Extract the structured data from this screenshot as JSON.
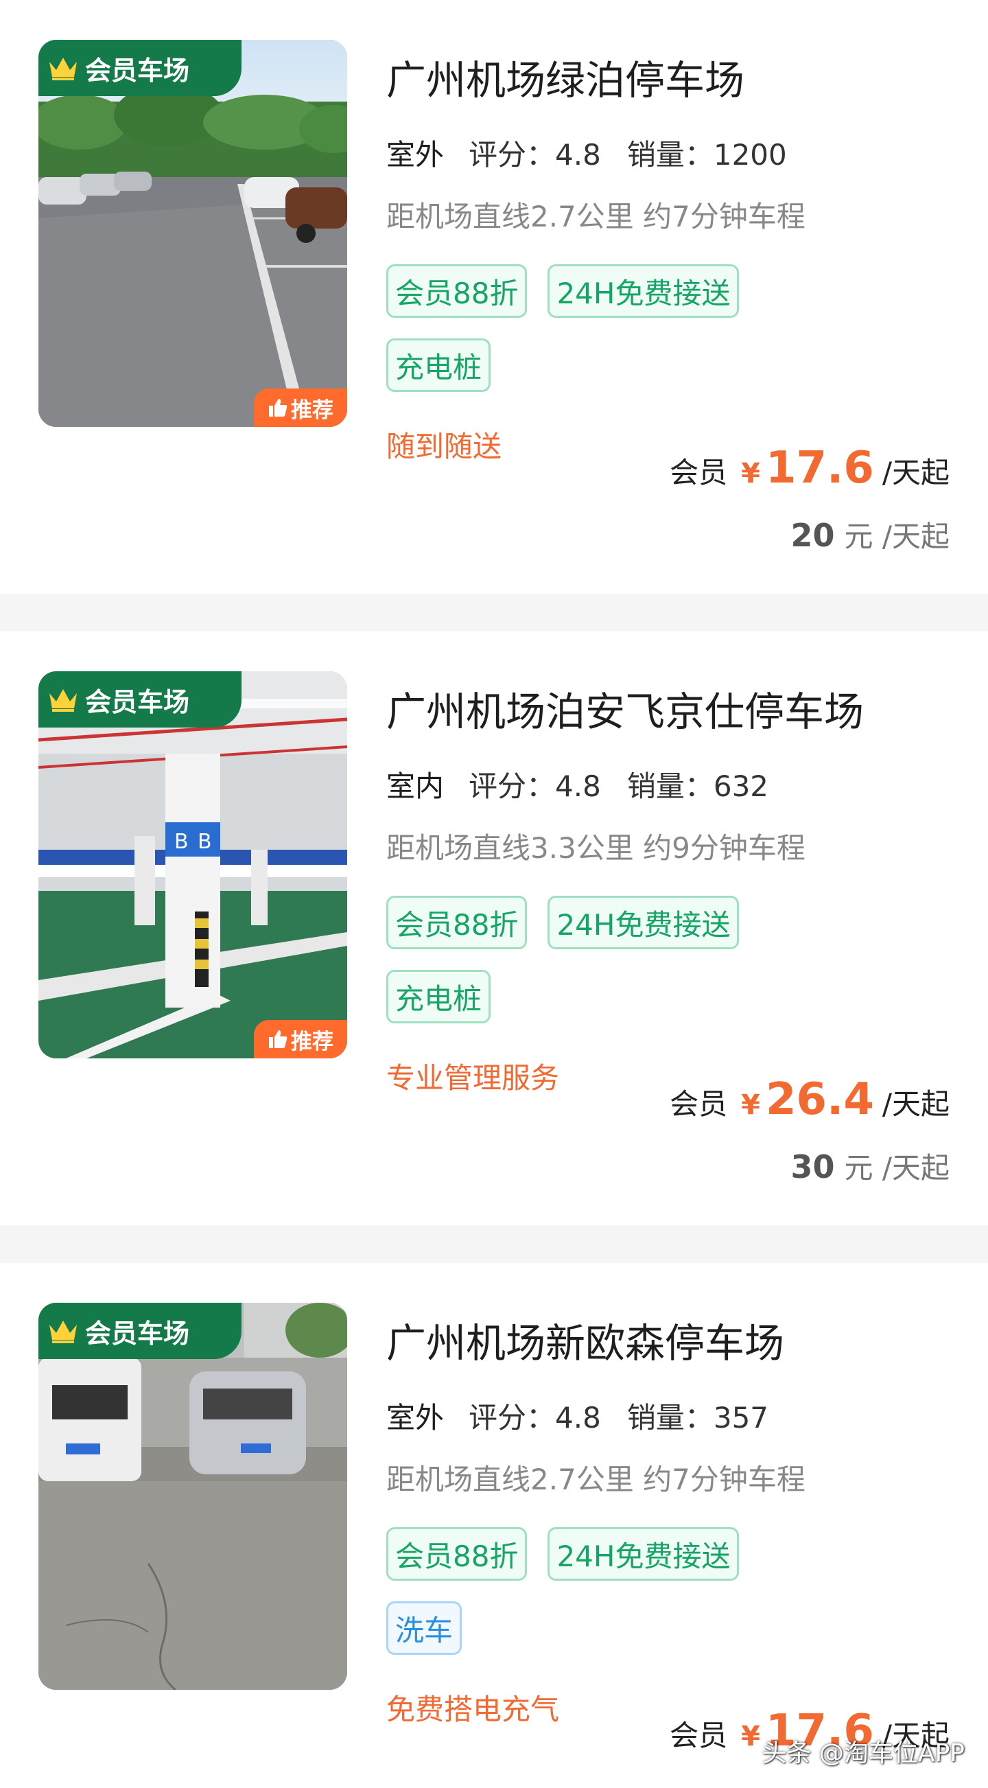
{
  "lots": [
    {
      "badge": "会员车场",
      "recommend": "推荐",
      "title": "广州机场绿泊停车场",
      "type": "室外",
      "rating_label": "评分：",
      "rating": "4.8",
      "sales_label": "销量：",
      "sales": "1200",
      "distance": "距机场直线2.7公里 约7分钟车程",
      "tags": [
        "会员88折",
        "24H免费接送",
        "充电桩"
      ],
      "slogan": "随到随送",
      "member_label": "会员",
      "currency": "¥",
      "member_price": "17.6",
      "price_unit": "/天起",
      "orig_price": "20",
      "orig_unit": "元 /天起"
    },
    {
      "badge": "会员车场",
      "recommend": "推荐",
      "title": "广州机场泊安飞京仕停车场",
      "type": "室内",
      "rating_label": "评分：",
      "rating": "4.8",
      "sales_label": "销量：",
      "sales": "632",
      "distance": "距机场直线3.3公里 约9分钟车程",
      "tags": [
        "会员88折",
        "24H免费接送",
        "充电桩"
      ],
      "slogan": "专业管理服务",
      "member_label": "会员",
      "currency": "¥",
      "member_price": "26.4",
      "price_unit": "/天起",
      "orig_price": "30",
      "orig_unit": "元 /天起"
    },
    {
      "badge": "会员车场",
      "title": "广州机场新欧森停车场",
      "type": "室外",
      "rating_label": "评分：",
      "rating": "4.8",
      "sales_label": "销量：",
      "sales": "357",
      "distance": "距机场直线2.7公里 约7分钟车程",
      "tags": [
        "会员88折",
        "24H免费接送",
        "洗车"
      ],
      "slogan": "免费搭电充气",
      "member_label": "会员",
      "currency": "¥",
      "member_price": "17.6",
      "price_unit": "/天起"
    }
  ],
  "watermark": "头条 @淘车位APP",
  "colors": {
    "brand_green": "#157a4a",
    "tag_green": "#16a565",
    "tag_blue": "#2a8fe0",
    "accent_orange": "#f26a32",
    "recommend_orange": "#ff6b2c"
  }
}
